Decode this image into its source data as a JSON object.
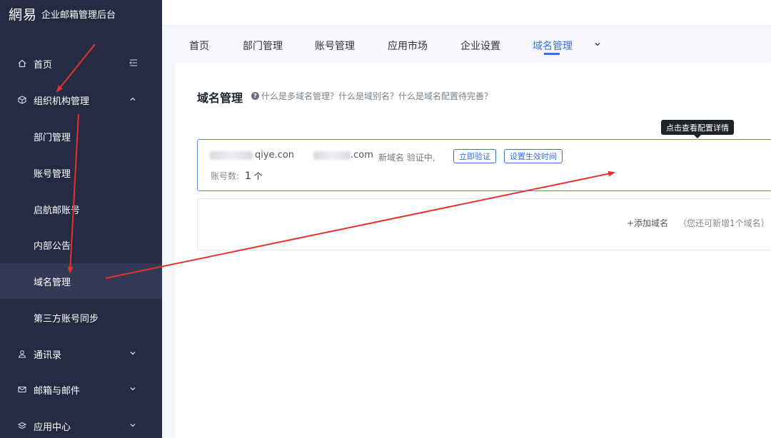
{
  "brand": {
    "logo": "網易",
    "title": "企业邮箱管理后台"
  },
  "sidebar": {
    "items": [
      {
        "label": "首页",
        "icon": "home-icon",
        "side_icon": "collapse-menu-icon"
      },
      {
        "label": "组织机构管理",
        "icon": "cube-icon",
        "chevron": "chevron-up-icon"
      },
      {
        "label": "部门管理"
      },
      {
        "label": "账号管理"
      },
      {
        "label": "启航邮账号"
      },
      {
        "label": "内部公告"
      },
      {
        "label": "域名管理",
        "active": true
      },
      {
        "label": "第三方账号同步"
      },
      {
        "label": "通讯录",
        "icon": "contacts-icon",
        "chevron": "chevron-down-icon"
      },
      {
        "label": "邮箱与邮件",
        "icon": "mail-icon",
        "chevron": "chevron-down-icon"
      },
      {
        "label": "应用中心",
        "icon": "app-center-icon",
        "chevron": "chevron-down-icon"
      }
    ]
  },
  "tabs": {
    "items": [
      "首页",
      "部门管理",
      "账号管理",
      "应用市场",
      "企业设置",
      "域名管理"
    ],
    "active": "域名管理"
  },
  "main": {
    "title": "域名管理",
    "help_text": "什么是多域名管理？什么是域别名？什么是域名配置待完善？",
    "tooltip": "点击查看配置详情",
    "domain": {
      "name_fragment_1": "qiye.con",
      "name_fragment_2": ".com",
      "status": "新域名 验证中,",
      "verify_button": "立即验证",
      "effective_time_button": "设置生效时间",
      "account_label": "账号数:",
      "account_count": "1",
      "account_unit": "个"
    },
    "add_domain": {
      "link": "+添加域名",
      "hint": "（您还可新增1个域名）"
    }
  },
  "colors": {
    "sidebar_bg": "#252b43",
    "accent": "#3b6fd8",
    "annotation_arrow": "#e8312a"
  }
}
